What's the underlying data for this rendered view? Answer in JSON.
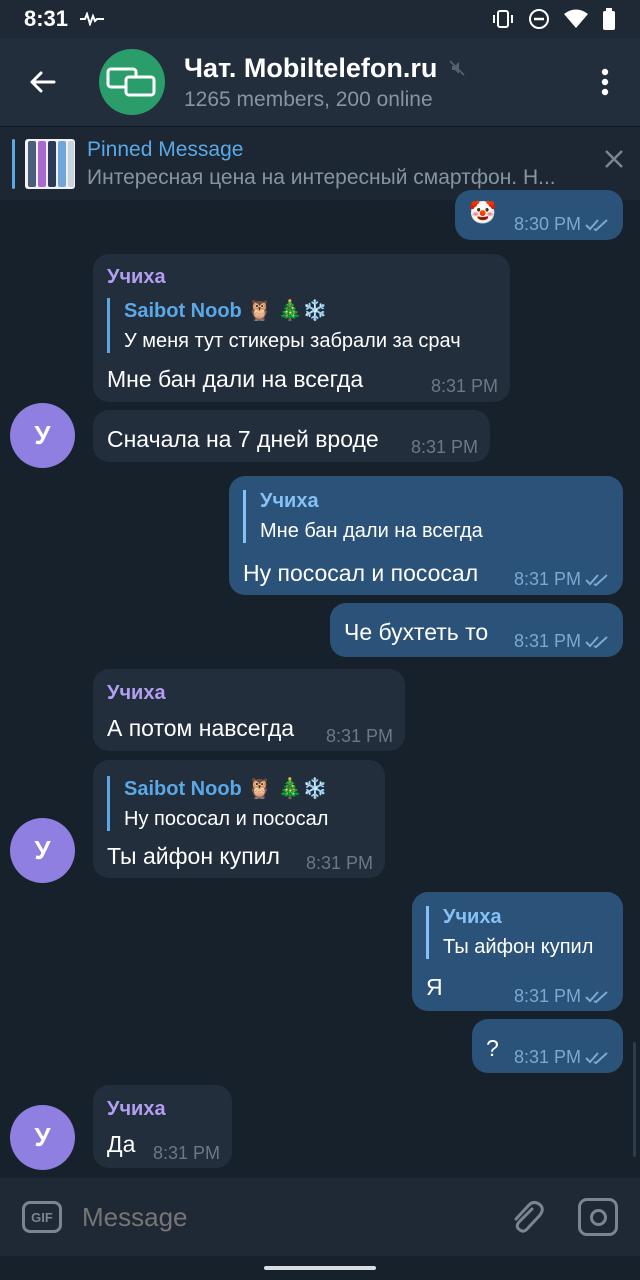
{
  "status": {
    "time": "8:31"
  },
  "header": {
    "title": "Чат. Mobiltelefon.ru",
    "subtitle": "1265 members, 200 online"
  },
  "pinned": {
    "title": "Pinned Message",
    "text": "Интересная цена на интересный смартфон. Н..."
  },
  "messages": [
    {
      "dir": "out",
      "sticker": "🤡",
      "time": "8:30 PM"
    },
    {
      "dir": "in",
      "sender": "Учиха",
      "reply_name": "Saibot Noob 🦉 🎄❄️",
      "reply_text": "У меня тут стикеры забрали за срач",
      "text": "Мне бан дали на всегда",
      "time": "8:31 PM"
    },
    {
      "dir": "in",
      "text": "Сначала на 7 дней вроде",
      "time": "8:31 PM",
      "avatar": "У"
    },
    {
      "dir": "out",
      "reply_name": "Учиха",
      "reply_text": "Мне бан дали на всегда",
      "text": "Ну пососал и пососал",
      "time": "8:31 PM"
    },
    {
      "dir": "out",
      "text": "Че бухтеть то",
      "time": "8:31 PM"
    },
    {
      "dir": "in",
      "sender": "Учиха",
      "text": "А потом навсегда",
      "time": "8:31 PM"
    },
    {
      "dir": "in",
      "reply_name": "Saibot Noob 🦉 🎄❄️",
      "reply_text": "Ну пососал и пососал",
      "text": "Ты айфон купил",
      "time": "8:31 PM",
      "avatar": "У"
    },
    {
      "dir": "out",
      "reply_name": "Учиха",
      "reply_text": "Ты айфон купил",
      "text": "Я",
      "time": "8:31 PM"
    },
    {
      "dir": "out",
      "text": "?",
      "time": "8:31 PM"
    },
    {
      "dir": "in",
      "sender": "Учиха",
      "text": "Да",
      "time": "8:31 PM",
      "avatar": "У"
    }
  ],
  "input": {
    "placeholder": "Message",
    "gif_label": "GIF"
  },
  "colors": {
    "background": "#17212b",
    "incoming": "#232e3c",
    "outgoing": "#2b5278",
    "accent": "#5aa8e6",
    "sender": "#b49ef1",
    "avatar": "#8e7fe0"
  }
}
